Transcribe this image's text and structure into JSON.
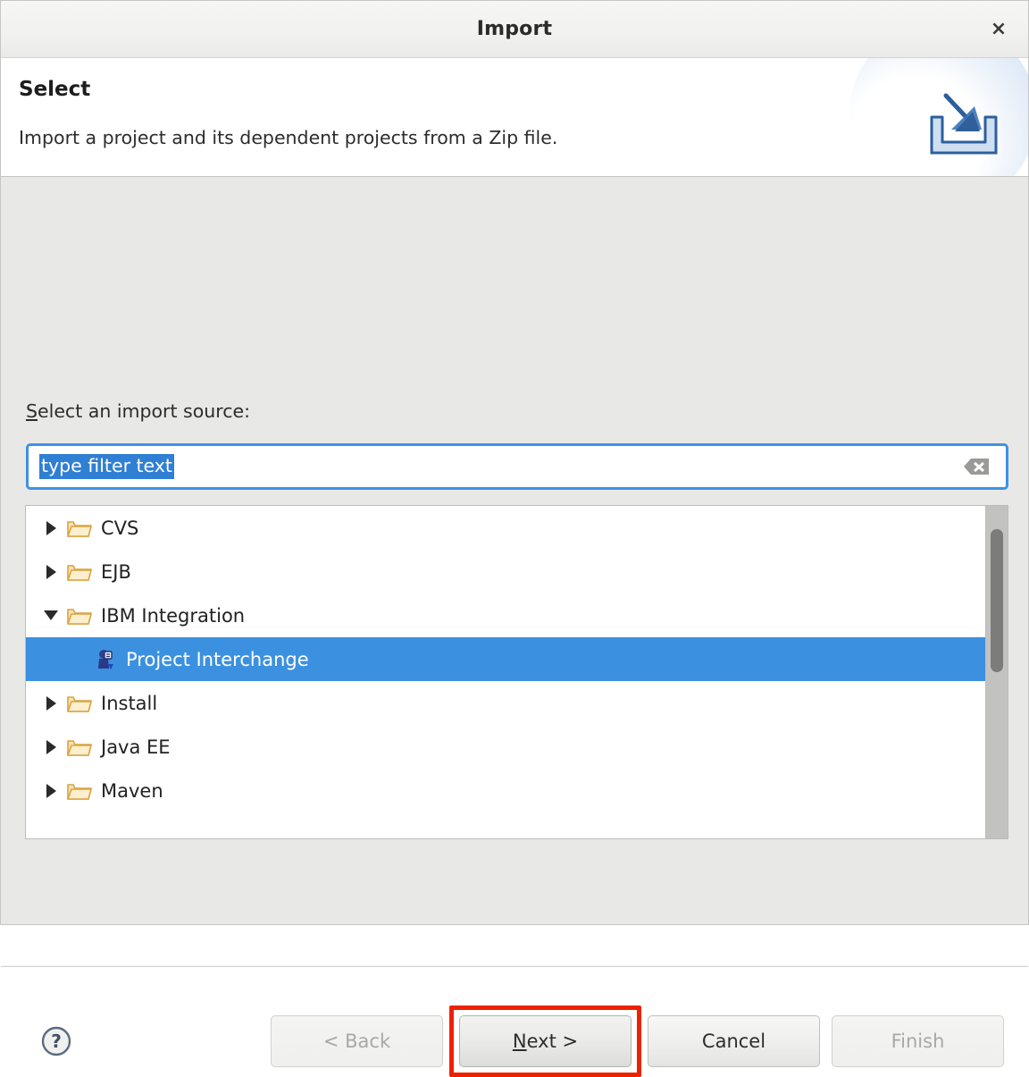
{
  "window": {
    "title": "Import",
    "close_label": "×",
    "close_icon": "close-icon"
  },
  "header": {
    "title": "Select",
    "description": "Import a project and its dependent projects from a Zip file.",
    "icon": "import-wizard-icon"
  },
  "form": {
    "label_prefix": "S",
    "label_rest": "elect an import source:",
    "filter": {
      "value": "type filter text",
      "placeholder": "type filter text",
      "selected": true,
      "clear_icon": "clear-filter-icon"
    }
  },
  "tree": {
    "items": [
      {
        "label": "CVS",
        "level": 0,
        "state": "collapsed",
        "icon": "folder-icon",
        "selected": false
      },
      {
        "label": "EJB",
        "level": 0,
        "state": "collapsed",
        "icon": "folder-icon",
        "selected": false
      },
      {
        "label": "IBM Integration",
        "level": 0,
        "state": "expanded",
        "icon": "folder-icon",
        "selected": false
      },
      {
        "label": "Project Interchange",
        "level": 1,
        "state": "leaf",
        "icon": "project-interchange-icon",
        "selected": true
      },
      {
        "label": "Install",
        "level": 0,
        "state": "collapsed",
        "icon": "folder-icon",
        "selected": false
      },
      {
        "label": "Java EE",
        "level": 0,
        "state": "collapsed",
        "icon": "folder-icon",
        "selected": false
      },
      {
        "label": "Maven",
        "level": 0,
        "state": "collapsed",
        "icon": "folder-icon",
        "selected": false
      }
    ],
    "scrollbar": {
      "thumb_top_pct": 7,
      "thumb_height_pct": 43
    }
  },
  "footer": {
    "help_icon": "help-icon",
    "buttons": [
      {
        "name": "back-button",
        "label": "< Back",
        "mnemonic": "",
        "enabled": false,
        "highlighted": false
      },
      {
        "name": "next-button",
        "label": "ext >",
        "mnemonic": "N",
        "enabled": true,
        "highlighted": true
      },
      {
        "name": "cancel-button",
        "label": "Cancel",
        "mnemonic": "",
        "enabled": true,
        "highlighted": false
      },
      {
        "name": "finish-button",
        "label": "Finish",
        "mnemonic": "",
        "enabled": false,
        "highlighted": false
      }
    ]
  },
  "colors": {
    "selection_blue": "#3b91e0",
    "focus_border_blue": "#3d91e6",
    "highlight_red": "#ee2200",
    "folder_tan": "#e8b96a",
    "dialog_gray": "#e8e8e6"
  }
}
